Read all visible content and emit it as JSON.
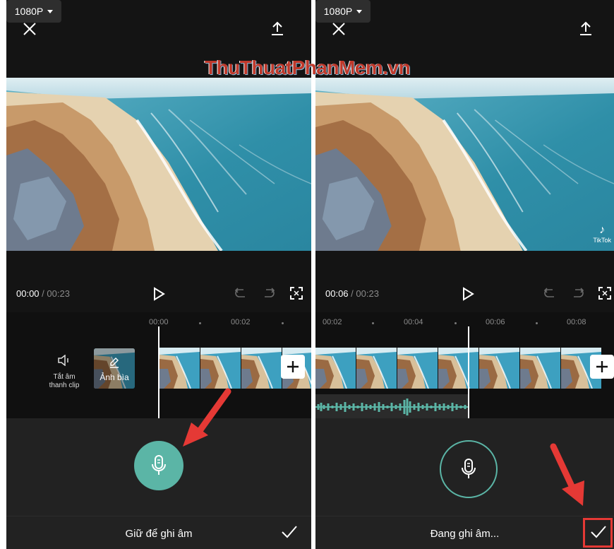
{
  "watermark": "ThuThuatPhanMem.vn",
  "colors": {
    "accent": "#5bb5a6",
    "annotation": "#e53935",
    "background": "#141414"
  },
  "panels": {
    "left": {
      "resolution": "1080P",
      "time_current": "00:00",
      "time_total": "00:23",
      "ruler": [
        "00:00",
        "00:02"
      ],
      "mute_label": "Tắt âm\nthanh clip",
      "cover_label": "Ảnh bìa",
      "bottom_label": "Giữ để ghi âm",
      "mic_state": "idle"
    },
    "right": {
      "resolution": "1080P",
      "time_current": "00:06",
      "time_total": "00:23",
      "ruler": [
        "00:02",
        "00:04",
        "00:06",
        "00:08"
      ],
      "bottom_label": "Đang ghi âm...",
      "mic_state": "recording",
      "tiktok_label": "TikTok"
    }
  },
  "icons": [
    "close-icon",
    "dropdown-caret-icon",
    "export-icon",
    "play-icon",
    "undo-icon",
    "redo-icon",
    "fullscreen-icon",
    "speaker-icon",
    "pencil-icon",
    "plus-icon",
    "microphone-icon",
    "checkmark-icon",
    "arrow-annotation"
  ]
}
